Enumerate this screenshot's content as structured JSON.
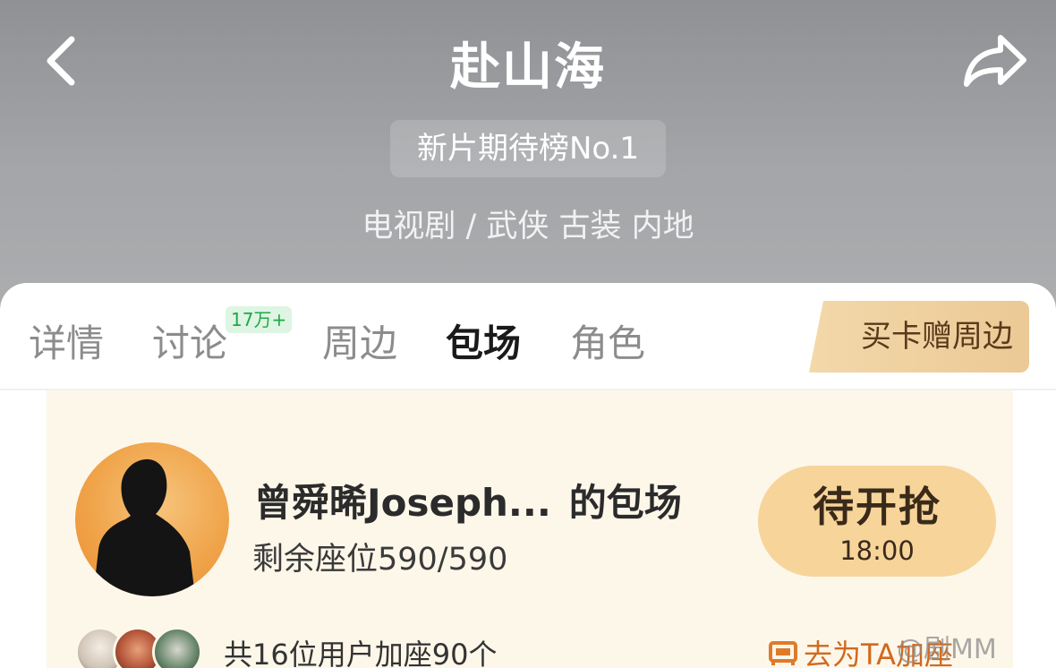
{
  "header": {
    "title": "赴山海",
    "rank_badge": "新片期待榜No.1",
    "genre_line": "电视剧 / 武侠 古装 内地"
  },
  "tabs": [
    {
      "label": "详情",
      "active": false
    },
    {
      "label": "讨论",
      "active": false,
      "badge": "17万+"
    },
    {
      "label": "周边",
      "active": false
    },
    {
      "label": "包场",
      "active": true
    },
    {
      "label": "角色",
      "active": false
    }
  ],
  "promo": {
    "label": "买卡赠周边"
  },
  "screening": {
    "host_name": "曾舜晞Joseph...",
    "host_suffix": "的包场",
    "seats_text": "剩余座位590/590",
    "grab_button": {
      "label": "待开抢",
      "time": "18:00"
    },
    "joined_text": "共16位用户加座90个",
    "join_link": "去为TA加座"
  },
  "watermark": "@剧MM",
  "colors": {
    "header_bg": "#9c9ea1",
    "card_bg": "#fdf7ea",
    "accent_gold": "#f7d49a",
    "badge_green": "#20a845",
    "link_orange": "#d2691e"
  },
  "icons": [
    "back-arrow-icon",
    "share-icon",
    "sofa-icon"
  ]
}
